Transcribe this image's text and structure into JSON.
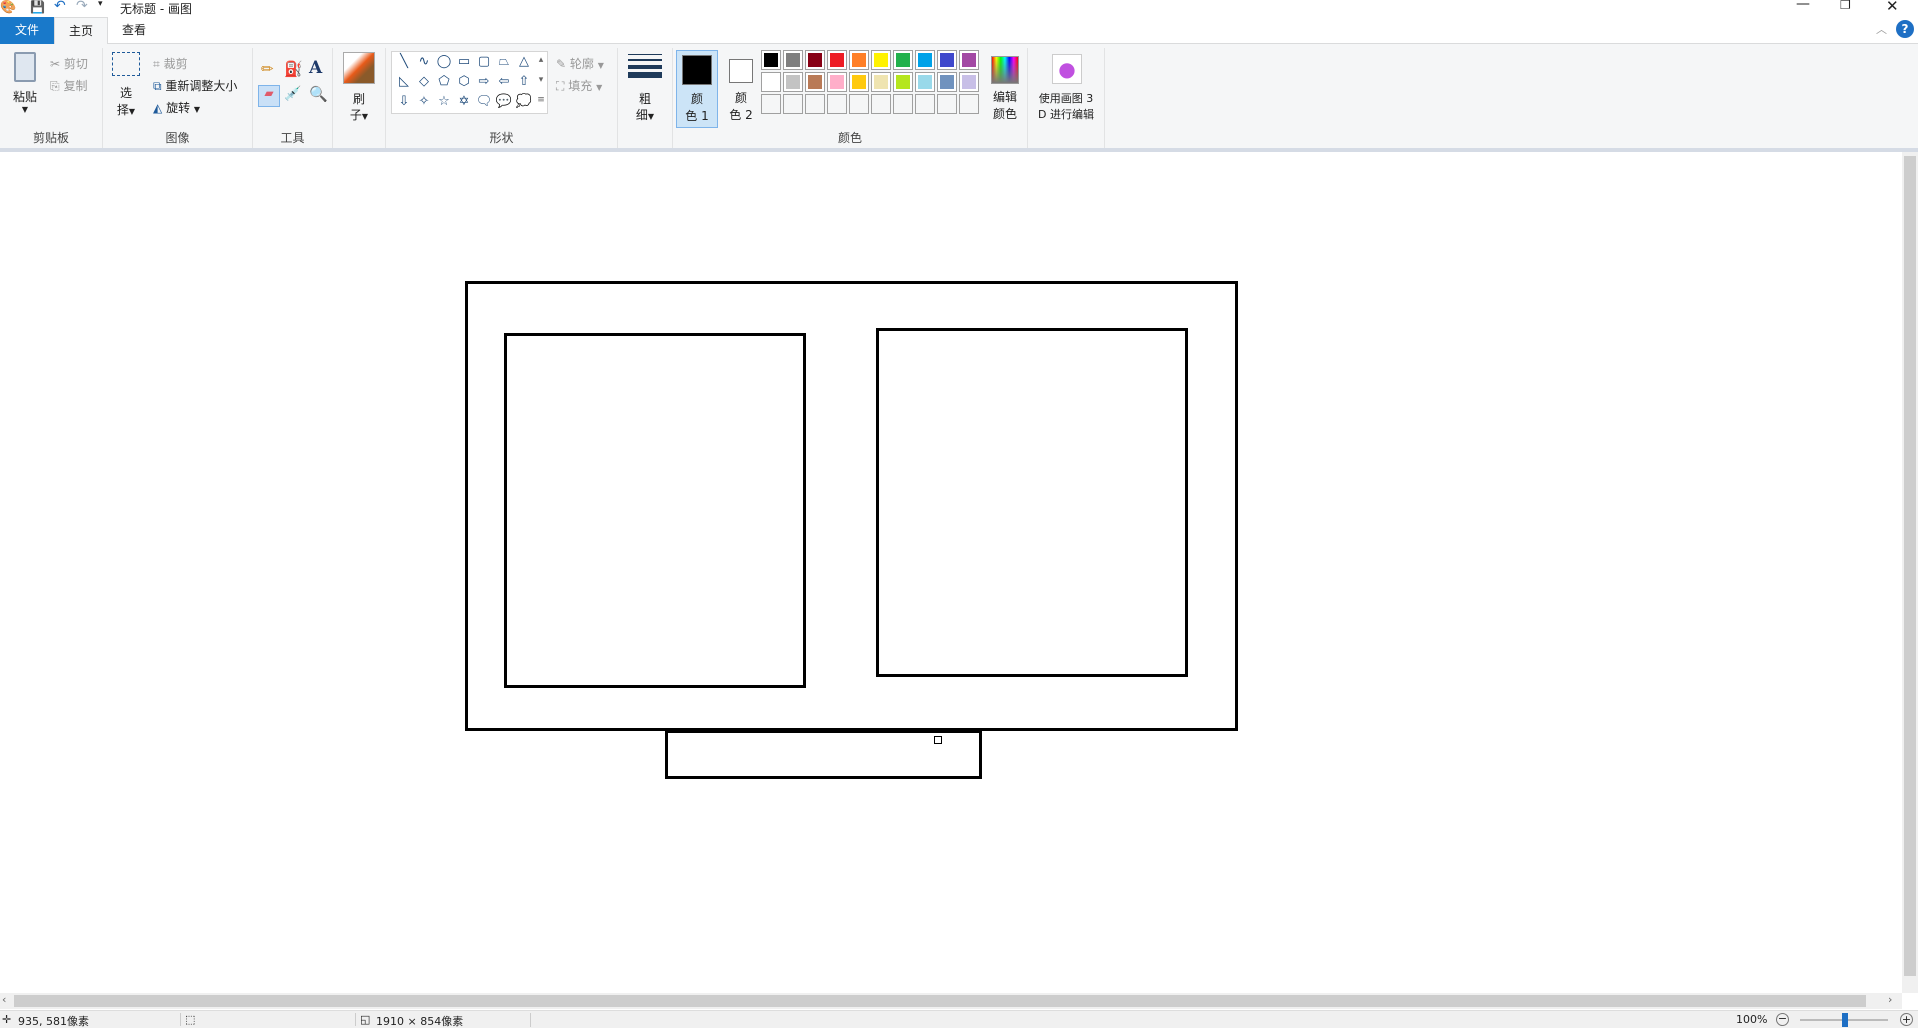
{
  "window": {
    "title": "无标题 - 画图",
    "minimize_icon": "minimize-icon",
    "restore_icon": "restore-icon",
    "close_icon": "close-icon"
  },
  "tabs": [
    {
      "label": "文件",
      "active": false,
      "accent": "#1979ca"
    },
    {
      "label": "主页",
      "active": true
    },
    {
      "label": "查看",
      "active": false
    }
  ],
  "ribbon": {
    "clipboard": {
      "label": "剪贴板",
      "paste": "粘贴",
      "cut": "剪切",
      "copy": "复制"
    },
    "image": {
      "label": "图像",
      "select_1": "选",
      "select_2": "择",
      "crop": "裁剪",
      "resize": "重新调整大小",
      "rotate": "旋转"
    },
    "tools": {
      "label": "工具"
    },
    "brushes": {
      "label_1": "刷",
      "label_2": "子"
    },
    "shapes": {
      "label": "形状",
      "outline": "轮廓",
      "fill": "填充",
      "items": [
        "╲",
        "∿",
        "◯",
        "▭",
        "▢",
        "⏢",
        "△",
        "◺",
        "◇",
        "⬠",
        "⬡",
        "⇨",
        "⇦",
        "⇧",
        "⇩",
        "✧",
        "☆",
        "✡",
        "🗨",
        "💬",
        "💭"
      ]
    },
    "size": {
      "label_1": "粗",
      "label_2": "细"
    },
    "colors": {
      "label": "颜色",
      "color1_1": "颜",
      "color1_2": "色 1",
      "color1_value": "#000000",
      "color2_1": "颜",
      "color2_2": "色 2",
      "color2_value": "#ffffff",
      "edit_1": "编辑",
      "edit_2": "颜色",
      "palette_row1": [
        "#000000",
        "#7f7f7f",
        "#880015",
        "#ed1c24",
        "#ff7f27",
        "#fff200",
        "#22b14c",
        "#00a2e8",
        "#3f48cc",
        "#a349a4"
      ],
      "palette_row2": [
        "#ffffff",
        "#c3c3c3",
        "#b97a57",
        "#ffaec9",
        "#ffc90e",
        "#efe4b0",
        "#b5e61d",
        "#99d9ea",
        "#7092be",
        "#c8bfe7"
      ]
    },
    "paint3d": {
      "label_1": "使用画图 3",
      "label_2": "D 进行编辑"
    }
  },
  "status": {
    "cursor_pos": "935, 581像素",
    "canvas_size": "1910 × 854像素",
    "zoom": "100%",
    "zoom_level_percent": 100
  }
}
